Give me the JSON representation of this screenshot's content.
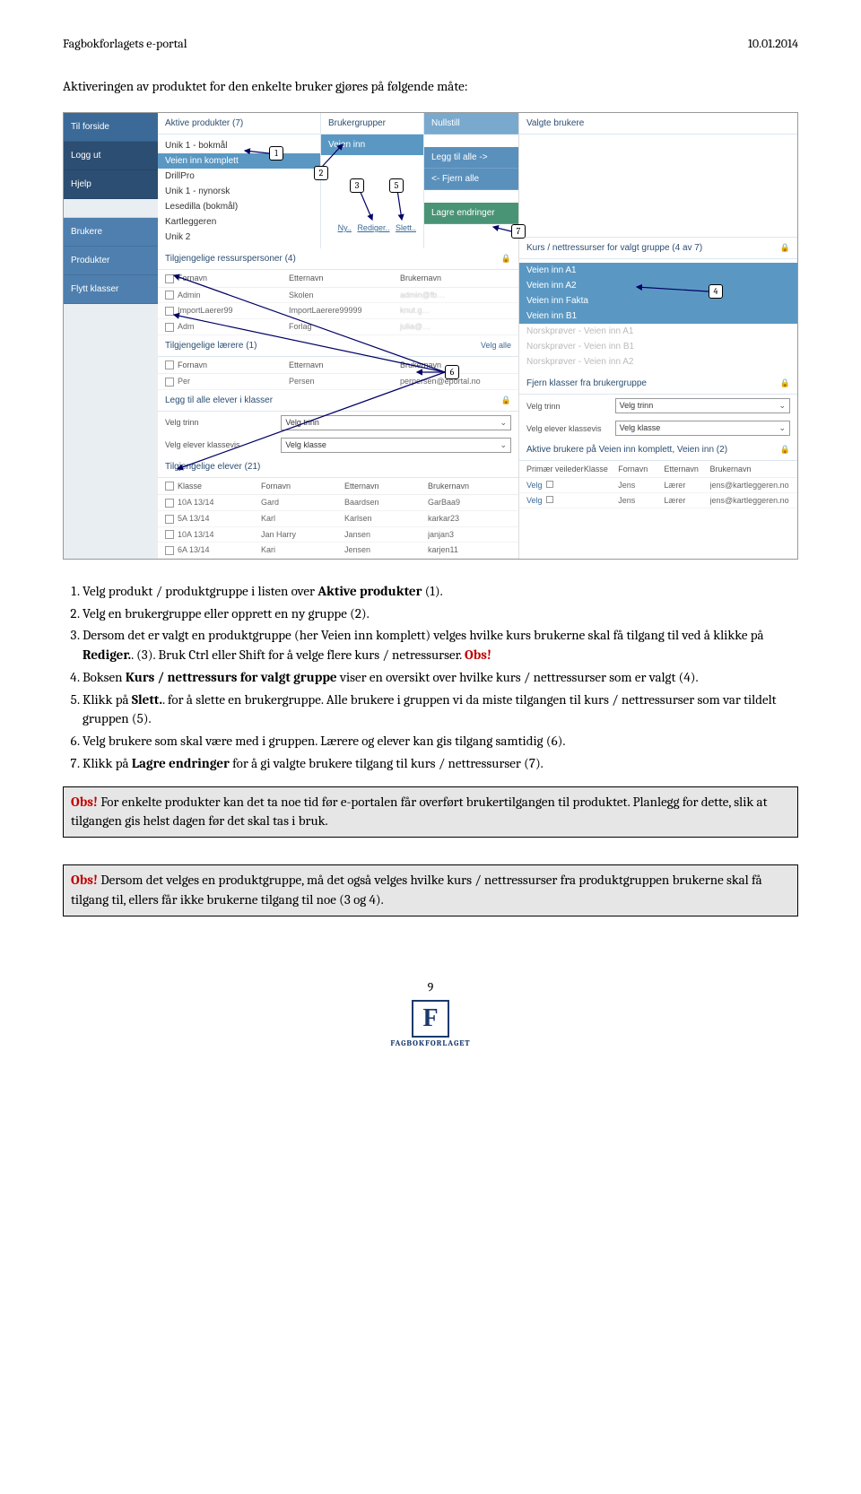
{
  "header": {
    "left": "Fagbokforlagets e-portal",
    "right": "10.01.2014"
  },
  "intro": "Aktiveringen av produktet for den enkelte bruker gjøres på følgende måte:",
  "sidebar": {
    "items": [
      {
        "label": "Til forside"
      },
      {
        "label": "Logg ut"
      },
      {
        "label": "Hjelp"
      },
      {
        "label": ""
      },
      {
        "label": "Brukere"
      },
      {
        "label": "Produkter"
      },
      {
        "label": "Flytt klasser"
      }
    ]
  },
  "products": {
    "title": "Aktive produkter (7)",
    "items": [
      "Unik 1 - bokmål",
      "Veien inn komplett",
      "DrillPro",
      "Unik 1 - nynorsk",
      "Lesedilla (bokmål)",
      "Kartleggeren",
      "Unik 2"
    ],
    "selected_index": 1
  },
  "groups": {
    "title": "Brukergrupper",
    "items": [
      "Veien inn"
    ],
    "links": {
      "ny": "Ny..",
      "rediger": "Rediger..",
      "slett": "Slett.."
    }
  },
  "center_right_buttons": {
    "nullstill": "Nullstill",
    "legg_til": "Legg til alle ->",
    "fjern_alle": "<- Fjern alle",
    "lagre": "Lagre endringer"
  },
  "ressurs": {
    "title": "Tilgjengelige ressurspersoner (4)",
    "headers": [
      "Fornavn",
      "Etternavn",
      "Brukernavn"
    ],
    "rows": [
      [
        "Admin",
        "Skolen",
        "admin@fb…"
      ],
      [
        "ImportLaerer99",
        "ImportLaerere99999",
        "knut.g…"
      ],
      [
        "Adm",
        "Forlag",
        "julia@…"
      ]
    ]
  },
  "laerere": {
    "title": "Tilgjengelige lærere (1)",
    "velg_alle": "Velg alle",
    "headers": [
      "Fornavn",
      "Etternavn",
      "Brukernavn"
    ],
    "rows": [
      [
        "Per",
        "Persen",
        "perpersen@eportal.no"
      ]
    ]
  },
  "legg_til_klasser": {
    "title": "Legg til alle elever i klasser",
    "rows": [
      {
        "label": "Velg trinn",
        "value": "Velg trinn"
      },
      {
        "label": "Velg elever klassevis",
        "value": "Velg klasse"
      }
    ]
  },
  "elever": {
    "title": "Tilgjengelige elever (21)",
    "headers": [
      "Klasse",
      "Fornavn",
      "Etternavn",
      "Brukernavn"
    ],
    "rows": [
      [
        "10A 13/14",
        "Gard",
        "Baardsen",
        "GarBaa9"
      ],
      [
        "5A 13/14",
        "Karl",
        "Karlsen",
        "karkar23"
      ],
      [
        "10A 13/14",
        "Jan Harry",
        "Jansen",
        "janjan3"
      ],
      [
        "6A 13/14",
        "Kari",
        "Jensen",
        "karjen11"
      ]
    ]
  },
  "valgte_brukere": {
    "title": "Valgte brukere"
  },
  "kurs": {
    "title": "Kurs / nettressurser for valgt gruppe (4 av 7)",
    "items": [
      {
        "label": "Veien inn A1",
        "sel": true
      },
      {
        "label": "Veien inn A2",
        "sel": true
      },
      {
        "label": "Veien inn Fakta",
        "sel": true
      },
      {
        "label": "Veien inn B1",
        "sel": true
      },
      {
        "label": "Norskprøver - Veien inn A1",
        "sel": false
      },
      {
        "label": "Norskprøver - Veien inn B1",
        "sel": false
      },
      {
        "label": "Norskprøver - Veien inn A2",
        "sel": false
      }
    ]
  },
  "fjern_klasser": {
    "title": "Fjern klasser fra brukergruppe",
    "rows": [
      {
        "label": "Velg trinn",
        "value": "Velg trinn"
      },
      {
        "label": "Velg elever klassevis",
        "value": "Velg klasse"
      }
    ]
  },
  "aktive_brukere": {
    "title": "Aktive brukere på Veien inn komplett, Veien inn (2)",
    "headers": [
      "Primær veileder",
      "Klasse",
      "Fornavn",
      "Etternavn",
      "Brukernavn"
    ],
    "rows": [
      [
        "Velg",
        "",
        "Jens",
        "Lærer",
        "jens@kartleggeren.no"
      ],
      [
        "Velg",
        "",
        "Jens",
        "Lærer",
        "jens@kartleggeren.no"
      ]
    ]
  },
  "steps": [
    {
      "n": "1.",
      "html": "Velg produkt / produktgruppe i listen over <b class='k'>Aktive produkter</b> (1)."
    },
    {
      "n": "2.",
      "html": "Velg en brukergruppe eller opprett en ny gruppe (2)."
    },
    {
      "n": "3.",
      "html": "Dersom det er valgt en produktgruppe (her Veien inn komplett) velges hvilke kurs brukerne skal få tilgang til ved å klikke på <b class='k'>Rediger.</b>. (3). Bruk Ctrl eller Shift for å velge flere kurs / netressurser. <span class='obs'>Obs!</span>"
    },
    {
      "n": "4.",
      "html": "Boksen <b class='k'>Kurs / nettressurs for valgt gruppe</b> viser en oversikt over hvilke kurs / nettressurser som er valgt (4)."
    },
    {
      "n": "5.",
      "html": "Klikk på <b class='k'>Slett.</b>. for å slette en brukergruppe. Alle brukere i gruppen vi da miste tilgangen til kurs / nettressurser som var tildelt gruppen (5)."
    },
    {
      "n": "6.",
      "html": "Velg brukere som skal være med i gruppen. Lærere og elever kan gis tilgang samtidig (6)."
    },
    {
      "n": "7.",
      "html": "Klikk på <b class='k'>Lagre endringer</b> for å gi valgte brukere tilgang til kurs / nettressurser (7)."
    }
  ],
  "callout1": "<span class='obs'>Obs!</span> For enkelte produkter kan det ta noe tid før e-portalen får overført brukertilgangen til produktet. Planlegg for dette, slik at tilgangen gis helst dagen før det skal tas i bruk.",
  "callout2": "<span class='obs'>Obs!</span> Dersom det velges en produktgruppe, må det også velges hvilke kurs / nettressurser fra produktgruppen brukerne skal få tilgang til, ellers får ikke brukerne tilgang til noe (3 og 4).",
  "page_num": "9",
  "logo": "FAGBOKFORLAGET"
}
